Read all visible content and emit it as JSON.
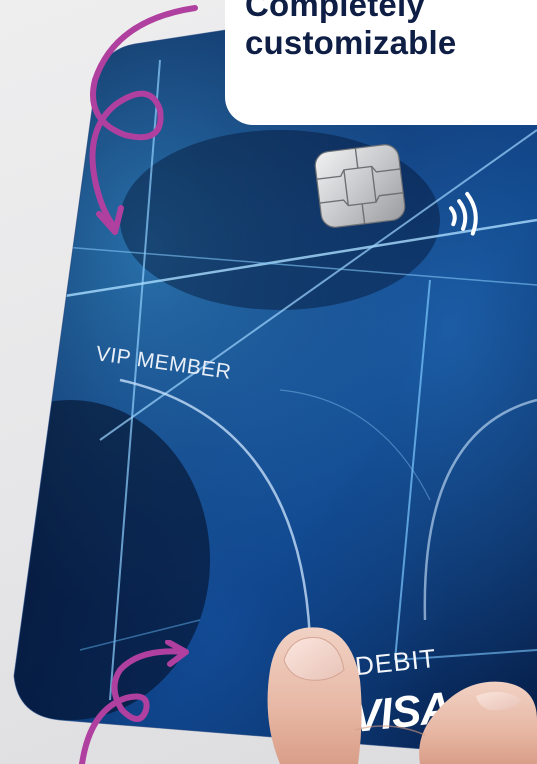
{
  "headline": {
    "line1": "Completely",
    "line2": "customizable"
  },
  "card": {
    "member_label": "VIP MEMBER",
    "debit_label": "DEBIT",
    "network_label": "VISA",
    "chip_icon": "chip-icon",
    "contactless_icon": "contactless-icon"
  },
  "decor": {
    "arrow_top_icon": "curly-arrow-icon",
    "arrow_bottom_icon": "curly-arrow-icon"
  },
  "colors": {
    "accent": "#b0409f",
    "headline": "#0e1e45",
    "card_dark": "#06122e",
    "card_mid": "#0f3a78",
    "card_glow": "#3fa7e6",
    "background": "#e8e8ea"
  }
}
